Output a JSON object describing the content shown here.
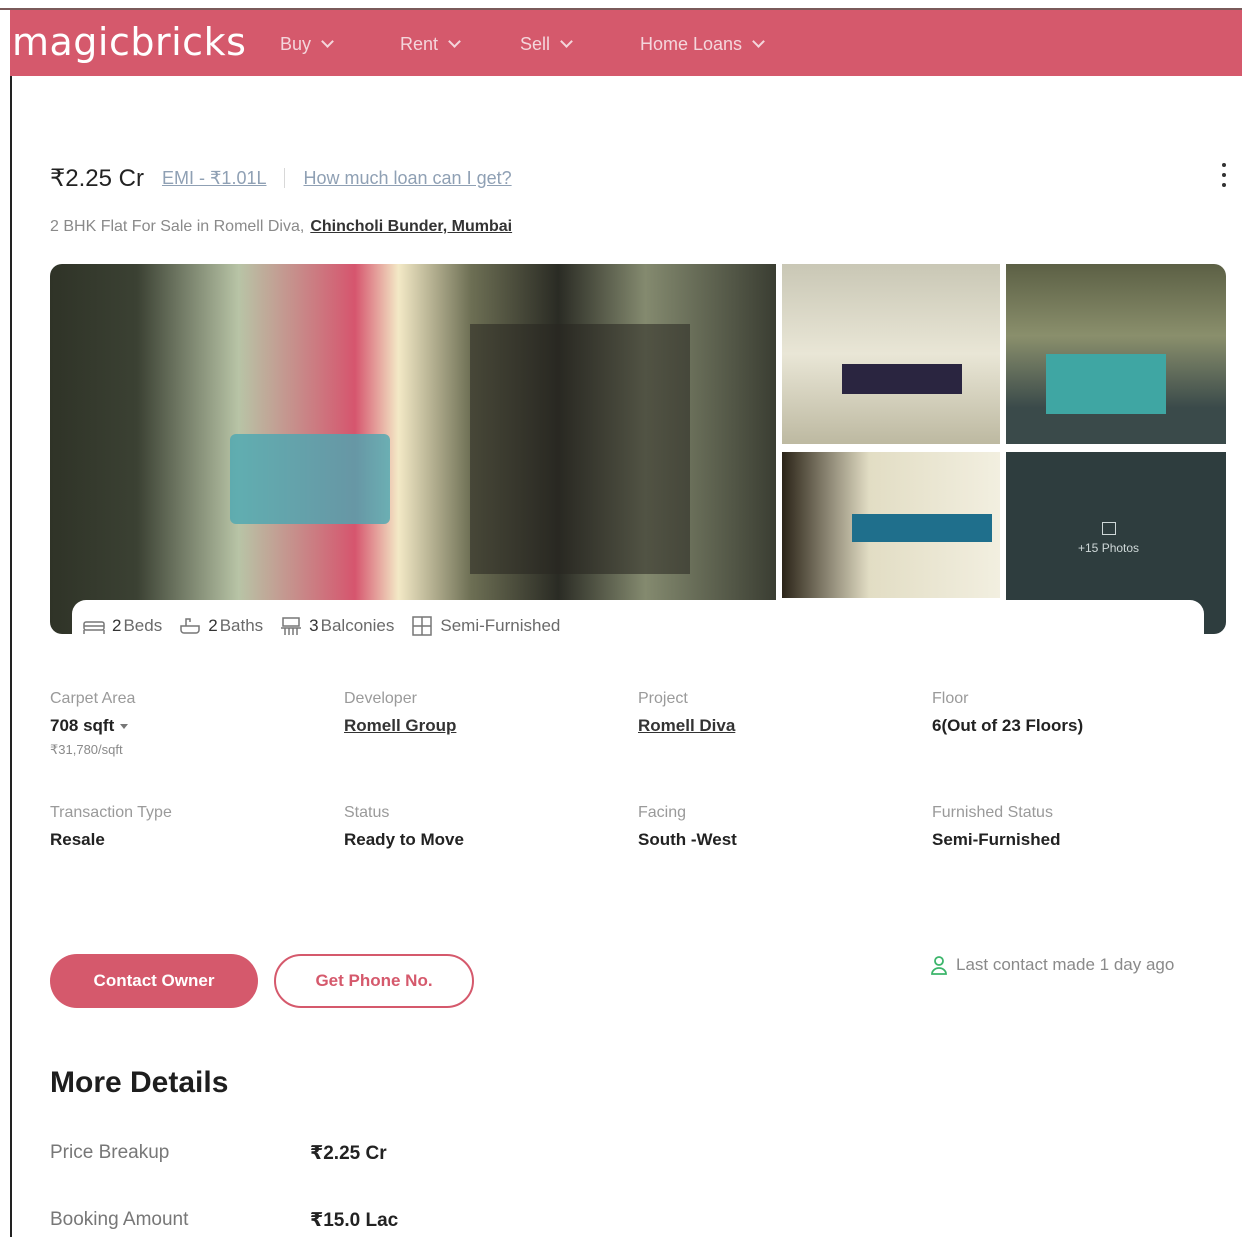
{
  "brand": {
    "logo": "magicbricks",
    "color": "#d5596c"
  },
  "nav": [
    {
      "label": "Buy"
    },
    {
      "label": "Rent"
    },
    {
      "label": "Sell"
    },
    {
      "label": "Home Loans"
    }
  ],
  "listing": {
    "price": "₹2.25 Cr",
    "emi": "EMI - ₹1.01L",
    "loan_link": "How much loan can I get?",
    "subtitle": "2 BHK Flat For Sale in Romell Diva,",
    "location": "Chincholi Bunder, Mumbai"
  },
  "gallery": {
    "photos_label": "+15 Photos"
  },
  "features": [
    {
      "icon": "bed-icon",
      "count": "2",
      "label": "Beds"
    },
    {
      "icon": "bath-icon",
      "count": "2",
      "label": "Baths"
    },
    {
      "icon": "balcony-icon",
      "count": "3",
      "label": "Balconies"
    },
    {
      "icon": "furnished-icon",
      "count": "",
      "label": "Semi-Furnished"
    }
  ],
  "summary": {
    "carpet_area": {
      "label": "Carpet Area",
      "value": "708 sqft",
      "sub": "₹31,780/sqft"
    },
    "developer": {
      "label": "Developer",
      "value": "Romell Group"
    },
    "project": {
      "label": "Project",
      "value": "Romell Diva"
    },
    "floor": {
      "label": "Floor",
      "value": "6(Out of 23 Floors)"
    },
    "transaction": {
      "label": "Transaction Type",
      "value": "Resale"
    },
    "status": {
      "label": "Status",
      "value": "Ready to Move"
    },
    "facing": {
      "label": "Facing",
      "value": "South -West"
    },
    "furnished": {
      "label": "Furnished Status",
      "value": "Semi-Furnished"
    }
  },
  "cta": {
    "contact_owner": "Contact Owner",
    "get_phone": "Get Phone No.",
    "last_contact": "Last contact made 1 day ago"
  },
  "more_details": {
    "title": "More Details",
    "rows": [
      {
        "key": "Price Breakup",
        "value": "₹2.25 Cr"
      },
      {
        "key": "Booking Amount",
        "value": "₹15.0 Lac"
      }
    ]
  }
}
